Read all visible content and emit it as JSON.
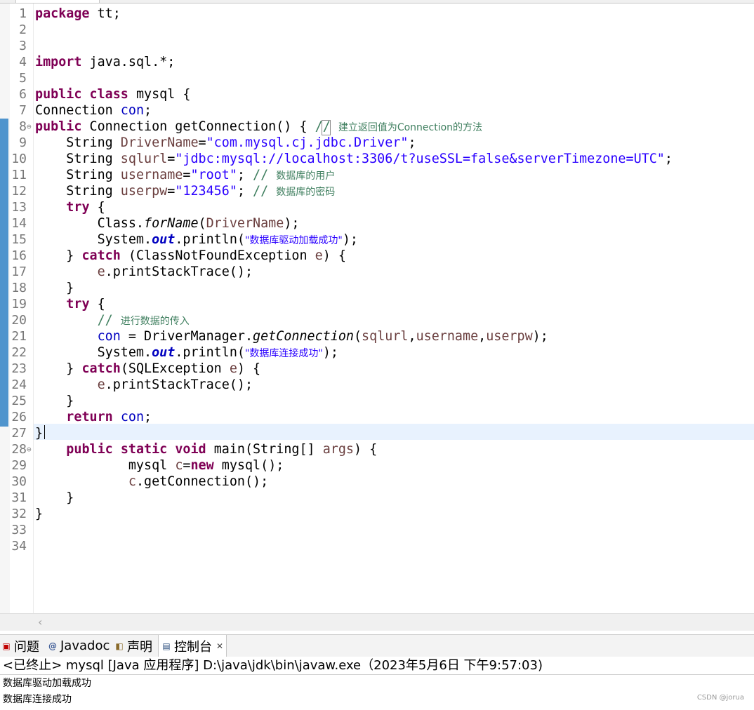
{
  "editor": {
    "line_numbers": [
      "1",
      "2",
      "3",
      "4",
      "5",
      "6",
      "7",
      "8",
      "9",
      "10",
      "11",
      "12",
      "13",
      "14",
      "15",
      "16",
      "17",
      "18",
      "19",
      "20",
      "21",
      "22",
      "23",
      "24",
      "25",
      "26",
      "27",
      "28",
      "29",
      "30",
      "31",
      "32",
      "33",
      "34"
    ],
    "code": {
      "l1_kw": "package",
      "l1_rest": " tt;",
      "l4_kw": "import",
      "l4_rest": " java.sql.*;",
      "l6_kw1": "public",
      "l6_sp": " ",
      "l6_kw2": "class",
      "l6_rest": " mysql {",
      "l7_type": "Connection ",
      "l7_fld": "con",
      "l7_semi": ";",
      "l8_kw": "public",
      "l8_rest": " Connection getConnection() ",
      "l8_brace": "{",
      "l8_cmt": " // ",
      "l8_cmt_text": "建立返回值为Connection的方法",
      "l9_type": "    String ",
      "l9_var": "DriverName",
      "l9_eq": "=",
      "l9_str": "\"com.mysql.cj.jdbc.Driver\"",
      "l9_semi": ";",
      "l10_type": "    String ",
      "l10_var": "sqlurl",
      "l10_eq": "=",
      "l10_str": "\"jdbc:mysql://localhost:3306/t?useSSL=false&serverTimezone=UTC\"",
      "l10_semi": ";",
      "l11_type": "    String ",
      "l11_var": "username",
      "l11_eq": "=",
      "l11_str": "\"root\"",
      "l11_semi": "; ",
      "l11_cmt": "// ",
      "l11_cmt_text": "数据库的用户",
      "l12_type": "    String ",
      "l12_var": "userpw",
      "l12_eq": "=",
      "l12_str": "\"123456\"",
      "l12_semi": "; ",
      "l12_cmt": "// ",
      "l12_cmt_text": "数据库的密码",
      "l13_ind": "    ",
      "l13_kw": "try",
      "l13_rest": " {",
      "l14_a": "        Class.",
      "l14_m": "forName",
      "l14_p1": "(",
      "l14_var": "DriverName",
      "l14_p2": ");",
      "l15_a": "        System.",
      "l15_f": "out",
      "l15_b": ".println(",
      "l15_str": "\"数据库驱动加载成功\"",
      "l15_c": ");",
      "l16_a": "    } ",
      "l16_kw": "catch",
      "l16_b": " (ClassNotFoundException ",
      "l16_var": "e",
      "l16_c": ") {",
      "l17_a": "        ",
      "l17_var": "e",
      "l17_b": ".printStackTrace();",
      "l18": "    }",
      "l19_ind": "    ",
      "l19_kw": "try",
      "l19_rest": " {",
      "l20_ind": "        ",
      "l20_cmt": "// ",
      "l20_cmt_text": "进行数据的传入",
      "l21_ind": "        ",
      "l21_fld": "con",
      "l21_a": " = DriverManager.",
      "l21_m": "getConnection",
      "l21_p": "(",
      "l21_v1": "sqlurl",
      "l21_c1": ",",
      "l21_v2": "username",
      "l21_c2": ",",
      "l21_v3": "userpw",
      "l21_e": ");",
      "l22_a": "        System.",
      "l22_f": "out",
      "l22_b": ".println(",
      "l22_str": "\"数据库连接成功\"",
      "l22_c": ");",
      "l23_a": "    } ",
      "l23_kw": "catch",
      "l23_b": "(SQLException ",
      "l23_var": "e",
      "l23_c": ") {",
      "l24_a": "        ",
      "l24_var": "e",
      "l24_b": ".printStackTrace();",
      "l25": "    }",
      "l26_ind": "    ",
      "l26_kw": "return",
      "l26_sp": " ",
      "l26_fld": "con",
      "l26_semi": ";",
      "l27": "}",
      "l28_ind": "    ",
      "l28_kw1": "public",
      "l28_sp1": " ",
      "l28_kw2": "static",
      "l28_sp2": " ",
      "l28_kw3": "void",
      "l28_a": " main(String[] ",
      "l28_var": "args",
      "l28_b": ") {",
      "l29_a": "            mysql ",
      "l29_var": "c",
      "l29_eq": "=",
      "l29_kw": "new",
      "l29_b": " mysql();",
      "l30_ind": "            ",
      "l30_var": "c",
      "l30_b": ".getConnection();",
      "l31": "    }",
      "l32": "}"
    }
  },
  "view_tabs": [
    {
      "label": "问题",
      "icon": "problems-icon"
    },
    {
      "label": "Javadoc",
      "icon": "javadoc-icon"
    },
    {
      "label": "声明",
      "icon": "declaration-icon"
    },
    {
      "label": "控制台",
      "icon": "console-icon"
    }
  ],
  "console": {
    "header": "<已终止> mysql [Java 应用程序] D:\\java\\jdk\\bin\\javaw.exe（2023年5月6日 下午9:57:03)",
    "lines": [
      "数据库驱动加载成功",
      "数据库连接成功"
    ]
  },
  "watermark": "CSDN @jorua"
}
